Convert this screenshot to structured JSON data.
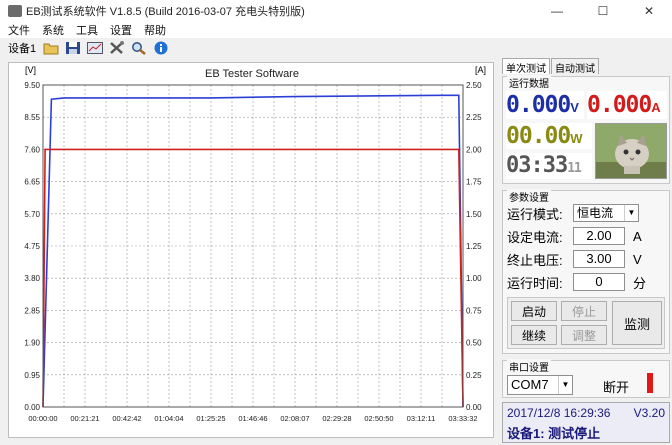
{
  "window": {
    "title": "EB测试系统软件 V1.8.5 (Build 2016-03-07 充电头特别版)",
    "min": "—",
    "max": "☐",
    "close": "✕"
  },
  "menu": [
    "文件",
    "系统",
    "工具",
    "设置",
    "帮助"
  ],
  "toolbar": {
    "device_label": "设备1"
  },
  "chart_data": {
    "type": "line",
    "title": "EB Tester Software",
    "ylabel_left": "[V]",
    "ylabel_right": "[A]",
    "ylim_left": [
      0,
      9.5
    ],
    "ylim_right": [
      0,
      2.5
    ],
    "yticks_left": [
      "9.50",
      "8.55",
      "7.60",
      "6.65",
      "5.70",
      "4.75",
      "3.80",
      "2.85",
      "1.90",
      "0.95",
      "0.00"
    ],
    "yticks_right": [
      "2.50",
      "2.25",
      "2.00",
      "1.75",
      "1.50",
      "1.25",
      "1.00",
      "0.75",
      "0.50",
      "0.25",
      "0.00"
    ],
    "xticks": [
      "00:00:00",
      "00:21:21",
      "00:42:42",
      "01:04:04",
      "01:25:25",
      "01:46:46",
      "02:08:07",
      "02:29:28",
      "02:50:50",
      "03:12:11",
      "03:33:32"
    ],
    "series": [
      {
        "axis": "right",
        "color": "#2b3fd6",
        "points": [
          [
            0,
            0
          ],
          [
            0.02,
            2.39
          ],
          [
            0.05,
            2.4
          ],
          [
            0.4,
            2.4
          ],
          [
            0.6,
            2.41
          ],
          [
            0.95,
            2.42
          ],
          [
            0.99,
            2.42
          ],
          [
            1.0,
            0
          ]
        ]
      },
      {
        "axis": "left",
        "color": "#d02020",
        "points": [
          [
            0,
            0
          ],
          [
            0.005,
            7.6
          ],
          [
            0.99,
            7.6
          ],
          [
            1.0,
            0
          ]
        ]
      }
    ]
  },
  "right_panel": {
    "tabs": [
      "单次测试",
      "自动测试"
    ],
    "run_data": {
      "title": "运行数据",
      "voltage": "0.000",
      "voltage_unit": "V",
      "current": "0.000",
      "current_unit": "A",
      "power": "00.00",
      "power_unit": "W",
      "time_main": "03:33",
      "time_sec": "11"
    },
    "params": {
      "title": "参数设置",
      "mode_label": "运行模式:",
      "mode_value": "恒电流",
      "current_label": "设定电流:",
      "current_value": "2.00",
      "current_unit": "A",
      "cutoff_label": "终止电压:",
      "cutoff_value": "3.00",
      "cutoff_unit": "V",
      "time_label": "运行时间:",
      "time_value": "0",
      "time_unit": "分",
      "start": "启动",
      "stop": "停止",
      "resume": "继续",
      "adjust": "调整",
      "monitor": "监测"
    },
    "serial": {
      "title": "串口设置",
      "port": "COM7",
      "status": "断开"
    },
    "status": {
      "datetime": "2017/12/8 16:29:36",
      "version": "V3.20",
      "message": "设备1: 测试停止"
    }
  },
  "colors": {
    "voltage": "#1c2fa8",
    "current": "#d41a1a",
    "power": "#8a8a12",
    "time": "#555555"
  }
}
